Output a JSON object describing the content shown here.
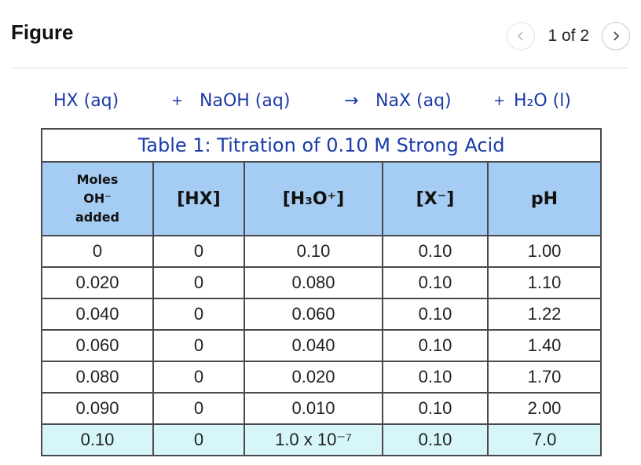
{
  "header": {
    "title": "Figure",
    "pager": "1 of 2",
    "prev_icon": "chevron-left",
    "next_icon": "chevron-right"
  },
  "figure": {
    "equation": {
      "reactant1": "HX (aq)",
      "plus1": "+",
      "reactant2": "NaOH (aq)",
      "arrow": "→",
      "product1": "NaX (aq)",
      "plus2": "+",
      "product2": "H₂O (l)"
    },
    "table": {
      "caption": "Table 1: Titration of 0.10 M Strong Acid",
      "headers": {
        "moles_line1": "Moles",
        "moles_line2": "OH⁻",
        "moles_line3": "added",
        "hx": "[HX]",
        "h3o": "[H₃O⁺]",
        "x": "[X⁻]",
        "ph": "pH"
      },
      "rows": [
        {
          "moles": "0",
          "hx": "0",
          "h3o": "0.10",
          "x": "0.10",
          "ph": "1.00"
        },
        {
          "moles": "0.020",
          "hx": "0",
          "h3o": "0.080",
          "x": "0.10",
          "ph": "1.10"
        },
        {
          "moles": "0.040",
          "hx": "0",
          "h3o": "0.060",
          "x": "0.10",
          "ph": "1.22"
        },
        {
          "moles": "0.060",
          "hx": "0",
          "h3o": "0.040",
          "x": "0.10",
          "ph": "1.40"
        },
        {
          "moles": "0.080",
          "hx": "0",
          "h3o": "0.020",
          "x": "0.10",
          "ph": "1.70"
        },
        {
          "moles": "0.090",
          "hx": "0",
          "h3o": "0.010",
          "x": "0.10",
          "ph": "2.00"
        },
        {
          "moles": "0.10",
          "hx": "0",
          "h3o": "1.0 x 10⁻⁷",
          "x": "0.10",
          "ph": "7.0"
        }
      ],
      "highlight_color": "#d6f6fa",
      "header_color": "#a5ccf2"
    },
    "accent_color": "#1a3aa8"
  }
}
